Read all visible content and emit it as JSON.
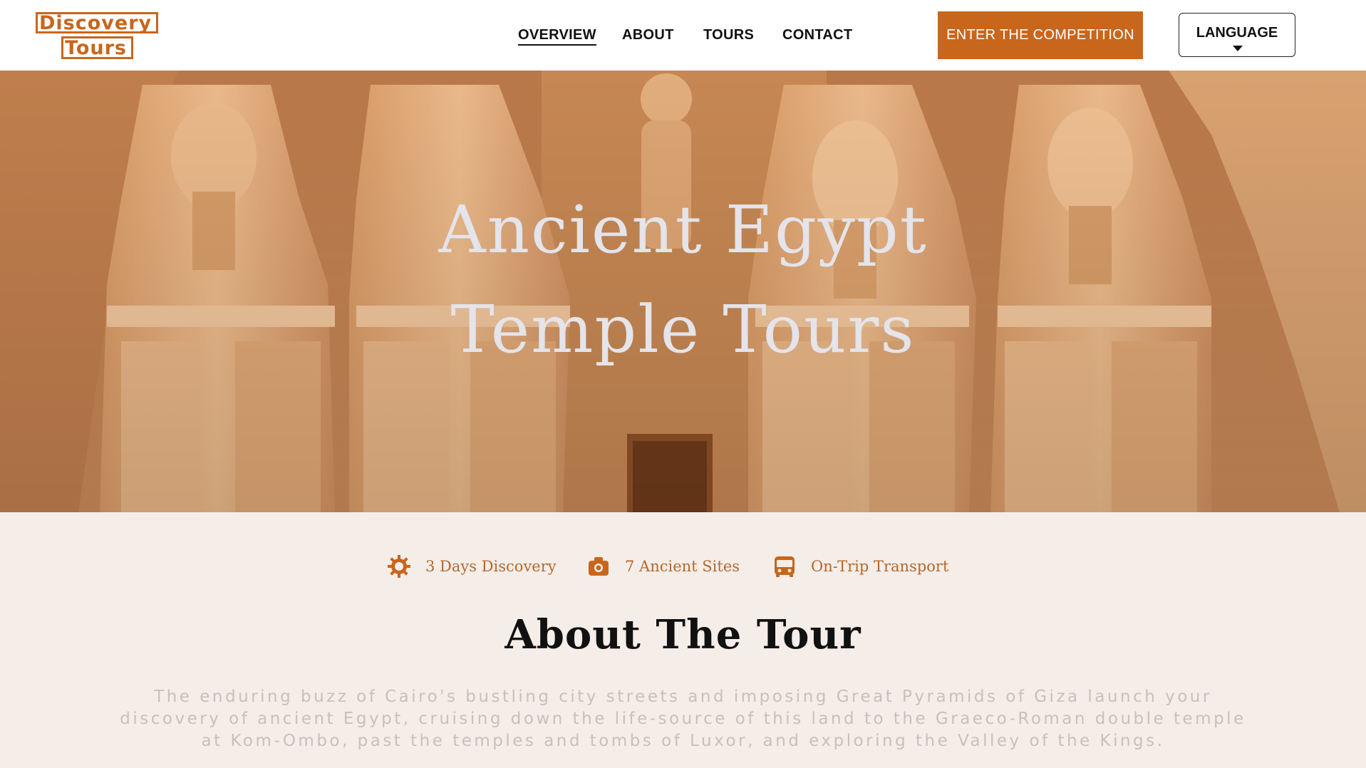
{
  "logo": {
    "line1": "Discovery",
    "line2": "Tours"
  },
  "nav": {
    "items": [
      {
        "label": "OVERVIEW",
        "active": true
      },
      {
        "label": "ABOUT",
        "active": false
      },
      {
        "label": "TOURS",
        "active": false
      },
      {
        "label": "CONTACT",
        "active": false
      }
    ]
  },
  "header": {
    "cta_label": "ENTER THE COMPETITION",
    "language_label": "LANGUAGE"
  },
  "hero": {
    "title_line1": "Ancient Egypt",
    "title_line2": "Temple Tours"
  },
  "features": [
    {
      "icon": "sun-icon",
      "label": "3 Days Discovery"
    },
    {
      "icon": "camera-icon",
      "label": "7 Ancient Sites"
    },
    {
      "icon": "bus-icon",
      "label": "On-Trip Transport"
    }
  ],
  "about": {
    "title": "About The Tour",
    "text": "The enduring buzz of Cairo's bustling city streets and imposing Great Pyramids of Giza launch your discovery of ancient Egypt, cruising down the life-source of this land to the Graeco-Roman double temple at Kom-Ombo, past the temples and tombs of Luxor, and exploring the Valley of the Kings."
  },
  "colors": {
    "accent": "#c8661c",
    "background": "#f5ede8",
    "hero_text": "#e4e4ea"
  }
}
